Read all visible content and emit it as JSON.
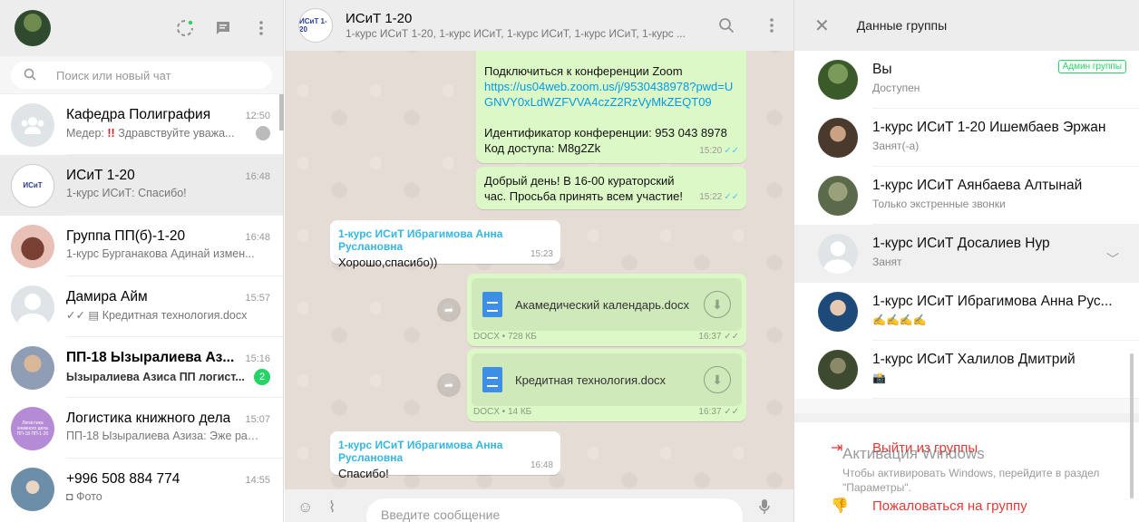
{
  "left": {
    "search_placeholder": "Поиск или новый чат",
    "chats": [
      {
        "name": "Кафедра Полиграфия",
        "time": "12:50",
        "prefix": "Медер: ",
        "excl": "!!",
        "preview": "Здравствуйте уважа...",
        "avatar_color": "#dfe5e7"
      },
      {
        "name": "ИСиТ 1-20",
        "time": "16:48",
        "preview": "1-курс ИСиТ: Спасибо!",
        "avatar_color": "#3a58b5"
      },
      {
        "name": "Группа  ПП(б)-1-20",
        "time": "16:48",
        "preview": "1-курс Бурганакова Адинай измен...",
        "avatar_color": "#c9857b"
      },
      {
        "name": "Дамира Айм",
        "time": "15:57",
        "preview": "✓✓ ▤ Кредитная технология.docx",
        "avatar_color": "#dfe5e7"
      },
      {
        "name": "ПП-18 Ызыралиева Аз...",
        "time": "15:16",
        "preview": "Ызыралиева Азиса ПП логист...",
        "unread": "2",
        "avatar_color": "#a9b5c7"
      },
      {
        "name": "Логистика книжного дела",
        "time": "15:07",
        "preview": "ПП-18 Ызыралиева Азиза: Эже раз...",
        "avatar_color": "#b58bd6",
        "avatar_text": "Логистика книжного дела ПП-18 ПП-1-20"
      },
      {
        "name": "+996 508 884 774",
        "time": "14:55",
        "preview": "◘ Фото",
        "avatar_color": "#7d9bb0"
      }
    ]
  },
  "mid": {
    "title": "ИСиТ 1-20",
    "subtitle": "1-курс ИСиТ 1-20, 1-курс ИСиТ, 1-курс ИСиТ, 1-курс ИСиТ, 1-курс ...",
    "avatar_text": "ИСиТ 1-20",
    "msg1": {
      "line1": "Подключиться к конференции Zoom",
      "link": "https://us04web.zoom.us/j/9530438978?pwd=UGNVY0xLdWZFVVA4czZ2RzVyMkZEQT09",
      "line3": "Идентификатор конференции: 953 043 8978",
      "line4": "Код доступа: M8g2Zk",
      "time": "15:20"
    },
    "msg2": {
      "text": "Добрый день! В 16-00 кураторский час. Просьба принять всем участие!",
      "time": "15:22"
    },
    "msg3": {
      "sender": "1-курс ИСиТ Ибрагимова Анна Руслановна",
      "text": "Хорошо,спасибо))",
      "time": "15:23"
    },
    "doc1": {
      "name": "Акамедический календарь.docx",
      "info": "DOCX • 728 КБ",
      "time": "16:37"
    },
    "doc2": {
      "name": "Кредитная технология.docx",
      "info": "DOCX • 14 КБ",
      "time": "16:37"
    },
    "msg4": {
      "sender": "1-курс ИСиТ Ибрагимова Анна Руслановна",
      "text": "Спасибо!",
      "time": "16:48"
    },
    "compose_placeholder": "Введите сообщение"
  },
  "right": {
    "title": "Данные группы",
    "members": [
      {
        "name": "Вы",
        "status": "Доступен",
        "badge": "Админ группы",
        "avatar_color": "#4a6a3a"
      },
      {
        "name": "1-курс ИСиТ  1-20 Ишембаев Эржан",
        "status": "Занят(-а)",
        "avatar_color": "#5d4b3c"
      },
      {
        "name": "1-курс ИСиТ Аянбаева Алтынай",
        "status": "Только экстренные звонки",
        "avatar_color": "#6f7a5a"
      },
      {
        "name": "1-курс ИСиТ Досалиев Нур",
        "status": "Занят",
        "avatar_color": "#dfe5e7"
      },
      {
        "name": "1-курс ИСиТ Ибрагимова Анна Рус...",
        "status": "✍✍✍✍",
        "avatar_color": "#2a5a8a"
      },
      {
        "name": "1-курс ИСиТ Халилов Дмитрий",
        "status": "📸",
        "avatar_color": "#505a40"
      }
    ],
    "exit_group": "Выйти из группы",
    "report_group": "Пожаловаться на группу",
    "watermark_title": "Активация Windows",
    "watermark_text": "Чтобы активировать Windows, перейдите в раздел \"Параметры\"."
  },
  "colors": {
    "accent": "#25d366",
    "outgoing": "#dcf8c6",
    "danger": "#e53935",
    "link": "#039be5"
  }
}
